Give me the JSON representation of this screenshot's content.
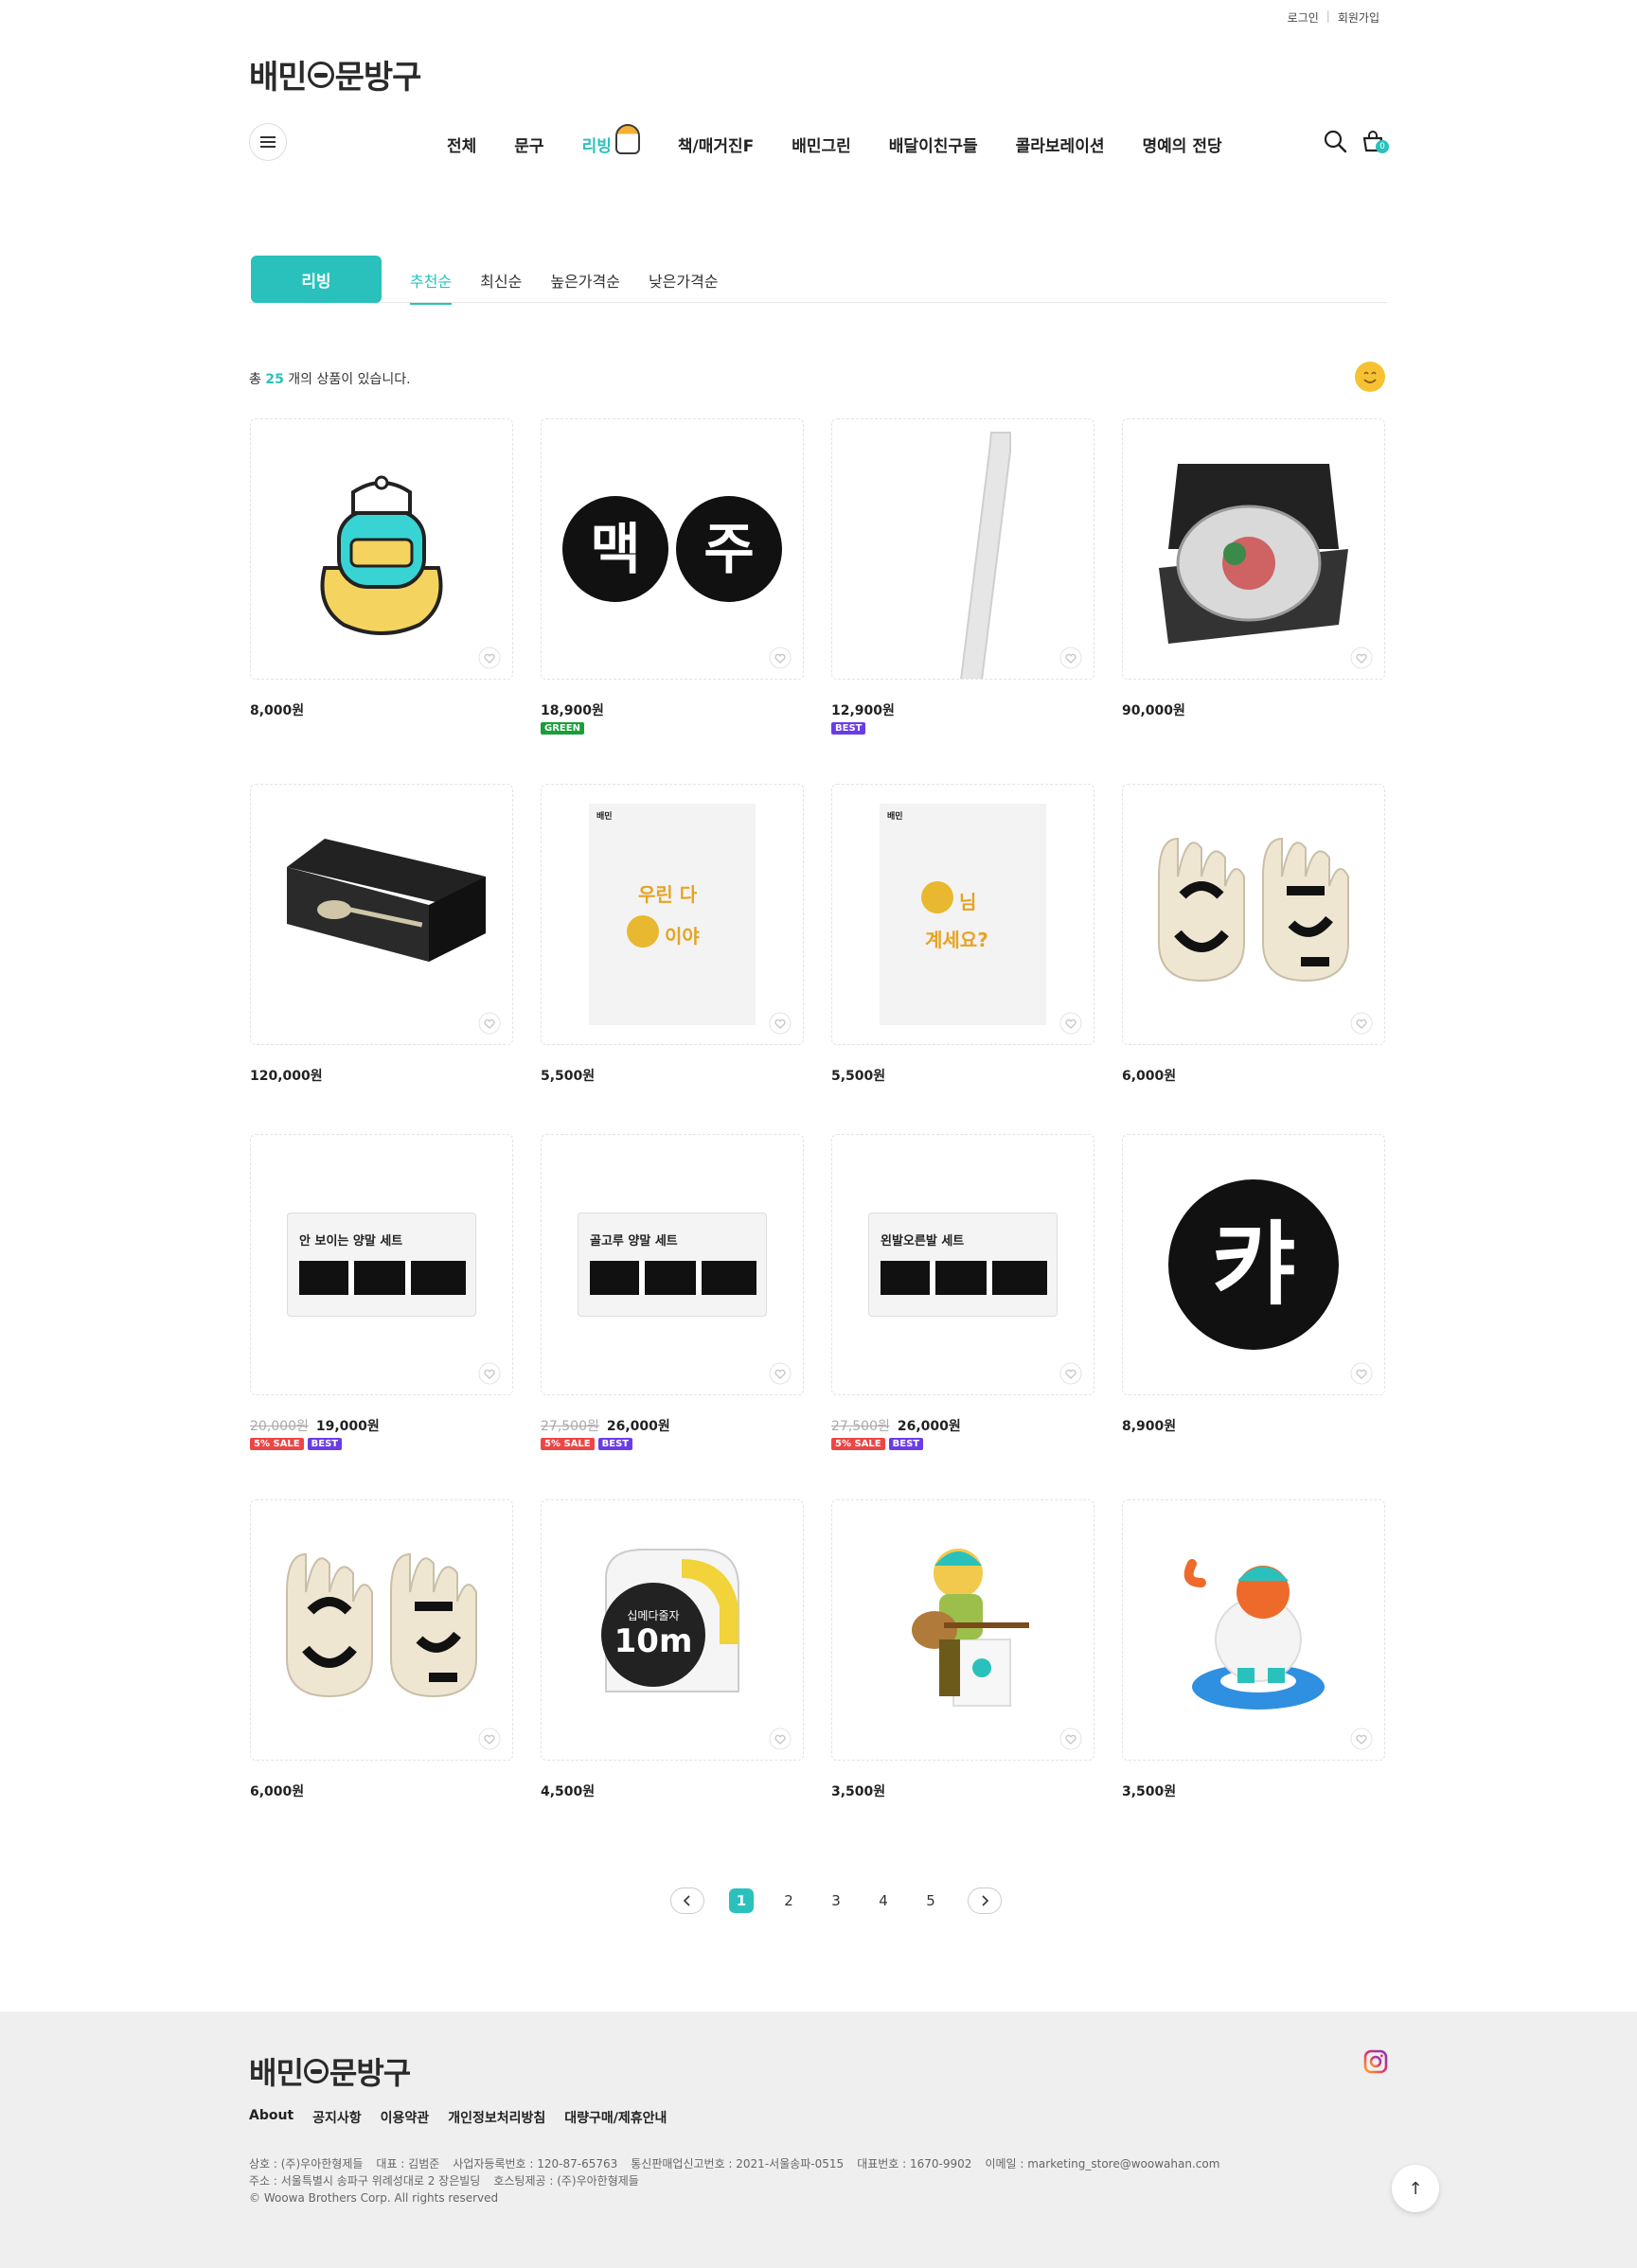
{
  "header": {
    "login": "로그인",
    "signup": "회원가입",
    "logo_left": "배민",
    "logo_right": "문방구",
    "nav": [
      "전체",
      "문구",
      "리빙",
      "책/매거진F",
      "배민그린",
      "배달이친구들",
      "콜라보레이션",
      "명예의 전당"
    ],
    "active_nav": "리빙",
    "cart_count": "0"
  },
  "filter": {
    "category": "리빙",
    "sorts": [
      "추천순",
      "최신순",
      "높은가격순",
      "낮은가격순"
    ],
    "active_sort": "추천순"
  },
  "summary": {
    "prefix": "총",
    "count": "25",
    "suffix": "개의 상품이 있습니다."
  },
  "products": [
    {
      "price": "8,000원",
      "image": "sticker-character",
      "badges": []
    },
    {
      "price": "18,900원",
      "image": "maekju-coasters",
      "badges": [
        "GREEN"
      ]
    },
    {
      "price": "12,900원",
      "image": "white-stick",
      "badges": [
        "BEST"
      ]
    },
    {
      "price": "90,000원",
      "image": "plate-giftbox",
      "badges": []
    },
    {
      "price": "120,000원",
      "image": "cutlery-box",
      "badges": []
    },
    {
      "price": "5,500원",
      "image": "card-uri-da",
      "badges": []
    },
    {
      "price": "5,500원",
      "image": "card-nim",
      "badges": []
    },
    {
      "price": "6,000원",
      "image": "gloves",
      "badges": []
    },
    {
      "orig_price": "20,000원",
      "price": "19,000원",
      "image": "socks-set-1",
      "badges": [
        "5% SALE",
        "BEST"
      ]
    },
    {
      "orig_price": "27,500원",
      "price": "26,000원",
      "image": "socks-set-2",
      "badges": [
        "5% SALE",
        "BEST"
      ]
    },
    {
      "orig_price": "27,500원",
      "price": "26,000원",
      "image": "socks-set-3",
      "badges": [
        "5% SALE",
        "BEST"
      ]
    },
    {
      "price": "8,900원",
      "image": "kya-coaster",
      "badges": []
    },
    {
      "price": "6,000원",
      "image": "gloves",
      "badges": []
    },
    {
      "price": "4,500원",
      "image": "tape-measure",
      "badges": []
    },
    {
      "price": "3,500원",
      "image": "figure-guitar",
      "badges": []
    },
    {
      "price": "3,500원",
      "image": "figure-cat",
      "badges": []
    }
  ],
  "product_art": {
    "maekju": [
      "맥",
      "주"
    ],
    "card1": {
      "brand": "배민",
      "line1": "우린 다",
      "line2": "이야"
    },
    "card2": {
      "brand": "배민",
      "line1": "님",
      "line2": "계세요?"
    },
    "socks1": "안 보이는 양말 세트",
    "socks2": "골고루 양말 세트",
    "socks3": "왼발오른발 세트",
    "kya": "캬",
    "tape": {
      "title": "십메다줄자",
      "size": "10m"
    }
  },
  "pagination": {
    "pages": [
      "1",
      "2",
      "3",
      "4",
      "5"
    ],
    "current": "1"
  },
  "footer": {
    "links": [
      "About",
      "공지사항",
      "이용약관",
      "개인정보처리방침",
      "대량구매/제휴안내"
    ],
    "info_row1": [
      "상호 : (주)우아한형제들",
      "대표 : 김범준",
      "사업자등록번호 : 120-87-65763",
      "통신판매업신고번호 : 2021-서울송파-0515",
      "대표번호 : 1670-9902",
      "이메일 : marketing_store@woowahan.com"
    ],
    "info_row2": [
      "주소 : 서울특별시 송파구 위례성대로 2 장은빌딩",
      "호스팅제공 : (주)우아한형제들"
    ],
    "copyright": "© Woowa Brothers Corp. All rights reserved",
    "top_button": "↑"
  },
  "colors": {
    "accent": "#2ac1bc",
    "best": "#6b3ce6",
    "green": "#1a9e3a",
    "sale": "#ee4545"
  }
}
